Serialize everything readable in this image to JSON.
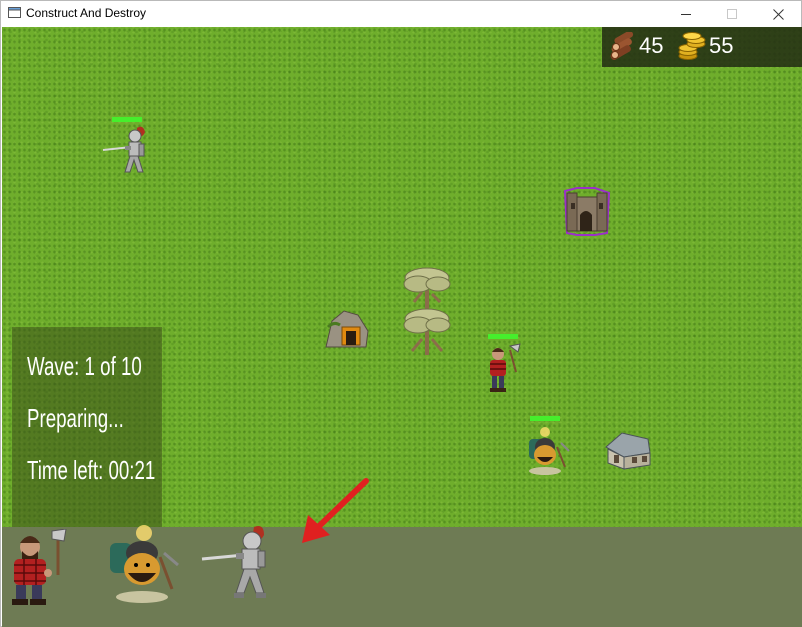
{
  "window": {
    "title": "Construct And Destroy",
    "icon": "app-window-icon",
    "controls": [
      "minimize-icon",
      "maximize-icon",
      "close-icon"
    ]
  },
  "resources": {
    "wood": {
      "icon": "wood-logs-icon",
      "value": "45"
    },
    "gold": {
      "icon": "gold-coins-icon",
      "value": "55"
    }
  },
  "wave_panel": {
    "wave": "Wave: 1 of 10",
    "status": "Preparing...",
    "time_left": "Time left: 00:21"
  },
  "map": {
    "units": [
      {
        "type": "knight",
        "health": 1.0
      },
      {
        "type": "lumberjack",
        "health": 1.0
      },
      {
        "type": "miner",
        "health": 1.0
      }
    ],
    "buildings": [
      "enemy-castle",
      "gold-mine",
      "tree",
      "tree",
      "house"
    ],
    "selection_color": "#9b30c8",
    "health_color": "#46ee2c"
  },
  "unit_bar": {
    "slots": [
      {
        "name": "lumberjack"
      },
      {
        "name": "miner"
      },
      {
        "name": "knight"
      }
    ],
    "arrow_color": "#e02020"
  }
}
